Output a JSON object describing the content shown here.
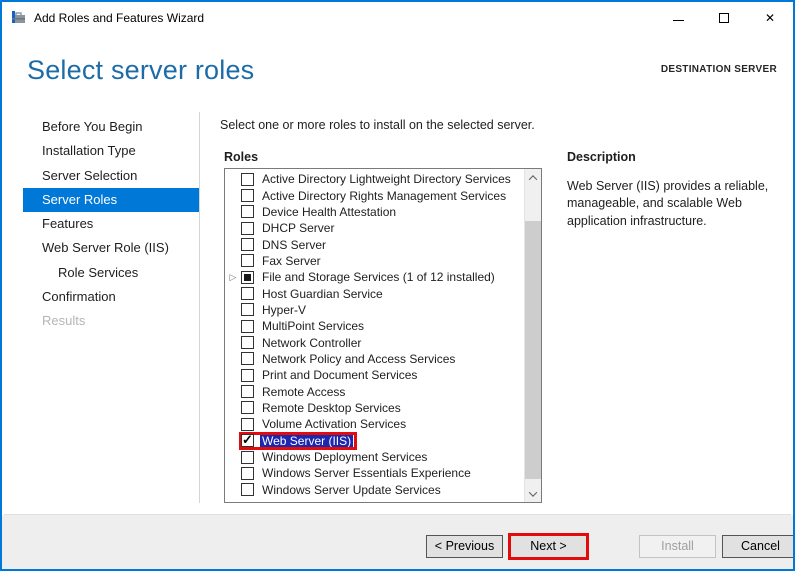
{
  "window": {
    "title": "Add Roles and Features Wizard"
  },
  "icons": {
    "app": "toolbox-icon",
    "minimize": "minimize-glyph",
    "maximize": "maximize-glyph",
    "close": "✕",
    "expander": "▷",
    "check": "✓",
    "scroll_up": "chevron-up",
    "scroll_down": "chevron-down"
  },
  "header": {
    "title": "Select server roles",
    "destination": "DESTINATION SERVER"
  },
  "sidebar": {
    "items": [
      {
        "label": "Before You Begin",
        "state": "normal"
      },
      {
        "label": "Installation Type",
        "state": "normal"
      },
      {
        "label": "Server Selection",
        "state": "normal"
      },
      {
        "label": "Server Roles",
        "state": "selected"
      },
      {
        "label": "Features",
        "state": "normal"
      },
      {
        "label": "Web Server Role (IIS)",
        "state": "normal"
      },
      {
        "label": "Role Services",
        "state": "normal",
        "indent": true
      },
      {
        "label": "Confirmation",
        "state": "normal"
      },
      {
        "label": "Results",
        "state": "disabled"
      }
    ]
  },
  "main": {
    "instruction": "Select one or more roles to install on the selected server.",
    "roles_label": "Roles",
    "roles": [
      {
        "label": "Active Directory Lightweight Directory Services",
        "checkbox": "unchecked"
      },
      {
        "label": "Active Directory Rights Management Services",
        "checkbox": "unchecked"
      },
      {
        "label": "Device Health Attestation",
        "checkbox": "unchecked"
      },
      {
        "label": "DHCP Server",
        "checkbox": "unchecked"
      },
      {
        "label": "DNS Server",
        "checkbox": "unchecked"
      },
      {
        "label": "Fax Server",
        "checkbox": "unchecked"
      },
      {
        "label": "File and Storage Services (1 of 12 installed)",
        "checkbox": "partial",
        "expandable": true
      },
      {
        "label": "Host Guardian Service",
        "checkbox": "unchecked"
      },
      {
        "label": "Hyper-V",
        "checkbox": "unchecked"
      },
      {
        "label": "MultiPoint Services",
        "checkbox": "unchecked"
      },
      {
        "label": "Network Controller",
        "checkbox": "unchecked"
      },
      {
        "label": "Network Policy and Access Services",
        "checkbox": "unchecked"
      },
      {
        "label": "Print and Document Services",
        "checkbox": "unchecked"
      },
      {
        "label": "Remote Access",
        "checkbox": "unchecked"
      },
      {
        "label": "Remote Desktop Services",
        "checkbox": "unchecked"
      },
      {
        "label": "Volume Activation Services",
        "checkbox": "unchecked"
      },
      {
        "label": "Web Server (IIS)",
        "checkbox": "checked",
        "selected": true,
        "annotated": true
      },
      {
        "label": "Windows Deployment Services",
        "checkbox": "unchecked"
      },
      {
        "label": "Windows Server Essentials Experience",
        "checkbox": "unchecked"
      },
      {
        "label": "Windows Server Update Services",
        "checkbox": "unchecked"
      }
    ]
  },
  "description": {
    "heading": "Description",
    "text": "Web Server (IIS) provides a reliable, manageable, and scalable Web application infrastructure."
  },
  "footer": {
    "buttons": [
      {
        "label": "< Previous",
        "state": "enabled"
      },
      {
        "label": "Next >",
        "state": "enabled",
        "annotated": true
      },
      {
        "label": "Install",
        "state": "disabled"
      },
      {
        "label": "Cancel",
        "state": "enabled"
      }
    ]
  },
  "colors": {
    "accent_blue": "#0078d7",
    "header_blue": "#1d6ca8",
    "selection_navy": "#1c27b0",
    "annotation_red": "#e30b0b"
  }
}
